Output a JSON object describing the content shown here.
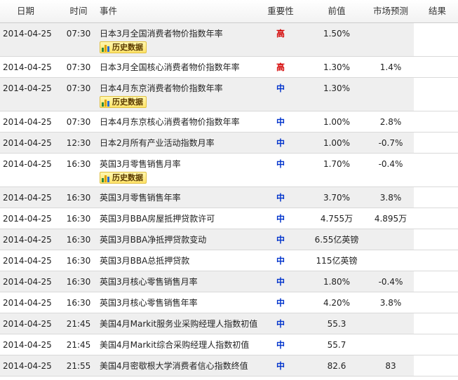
{
  "headers": {
    "date": "日期",
    "time": "时间",
    "event": "事件",
    "importance": "重要性",
    "previous": "前值",
    "forecast": "市场预测",
    "result": "结果"
  },
  "history_label": "历史数据",
  "colors": {
    "importance_high": "#d40000",
    "importance_medium": "#0033cc",
    "row_alt_background": "#efefef",
    "history_button": "#ffe36a"
  },
  "rows": [
    {
      "date": "2014-04-25",
      "time": "07:30",
      "event": "日本3月全国消费者物价指数年率",
      "importance": "高",
      "level": "high",
      "previous": "1.50%",
      "forecast": "",
      "result": "",
      "history": true
    },
    {
      "date": "2014-04-25",
      "time": "07:30",
      "event": "日本3月全国核心消费者物价指数年率",
      "importance": "高",
      "level": "high",
      "previous": "1.30%",
      "forecast": "1.4%",
      "result": "",
      "history": false
    },
    {
      "date": "2014-04-25",
      "time": "07:30",
      "event": "日本4月东京消费者物价指数年率",
      "importance": "中",
      "level": "medium",
      "previous": "1.30%",
      "forecast": "",
      "result": "",
      "history": true
    },
    {
      "date": "2014-04-25",
      "time": "07:30",
      "event": "日本4月东京核心消费者物价指数年率",
      "importance": "中",
      "level": "medium",
      "previous": "1.00%",
      "forecast": "2.8%",
      "result": "",
      "history": false
    },
    {
      "date": "2014-04-25",
      "time": "12:30",
      "event": "日本2月所有产业活动指数月率",
      "importance": "中",
      "level": "medium",
      "previous": "1.00%",
      "forecast": "-0.7%",
      "result": "",
      "history": false
    },
    {
      "date": "2014-04-25",
      "time": "16:30",
      "event": "英国3月零售销售月率",
      "importance": "中",
      "level": "medium",
      "previous": "1.70%",
      "forecast": "-0.4%",
      "result": "",
      "history": true
    },
    {
      "date": "2014-04-25",
      "time": "16:30",
      "event": "英国3月零售销售年率",
      "importance": "中",
      "level": "medium",
      "previous": "3.70%",
      "forecast": "3.8%",
      "result": "",
      "history": false
    },
    {
      "date": "2014-04-25",
      "time": "16:30",
      "event": "英国3月BBA房屋抵押贷款许可",
      "importance": "中",
      "level": "medium",
      "previous": "4.755万",
      "forecast": "4.895万",
      "result": "",
      "history": false
    },
    {
      "date": "2014-04-25",
      "time": "16:30",
      "event": "英国3月BBA净抵押贷款变动",
      "importance": "中",
      "level": "medium",
      "previous": "6.55亿英镑",
      "forecast": "",
      "result": "",
      "history": false
    },
    {
      "date": "2014-04-25",
      "time": "16:30",
      "event": "英国3月BBA总抵押贷款",
      "importance": "中",
      "level": "medium",
      "previous": "115亿英镑",
      "forecast": "",
      "result": "",
      "history": false
    },
    {
      "date": "2014-04-25",
      "time": "16:30",
      "event": "英国3月核心零售销售月率",
      "importance": "中",
      "level": "medium",
      "previous": "1.80%",
      "forecast": "-0.4%",
      "result": "",
      "history": false
    },
    {
      "date": "2014-04-25",
      "time": "16:30",
      "event": "英国3月核心零售销售年率",
      "importance": "中",
      "level": "medium",
      "previous": "4.20%",
      "forecast": "3.8%",
      "result": "",
      "history": false
    },
    {
      "date": "2014-04-25",
      "time": "21:45",
      "event": "美国4月Markit服务业采购经理人指数初值",
      "importance": "中",
      "level": "medium",
      "previous": "55.3",
      "forecast": "",
      "result": "",
      "history": false
    },
    {
      "date": "2014-04-25",
      "time": "21:45",
      "event": "美国4月Markit综合采购经理人指数初值",
      "importance": "中",
      "level": "medium",
      "previous": "55.7",
      "forecast": "",
      "result": "",
      "history": false
    },
    {
      "date": "2014-04-25",
      "time": "21:55",
      "event": "美国4月密歇根大学消费者信心指数终值",
      "importance": "中",
      "level": "medium",
      "previous": "82.6",
      "forecast": "83",
      "result": "",
      "history": false
    }
  ]
}
